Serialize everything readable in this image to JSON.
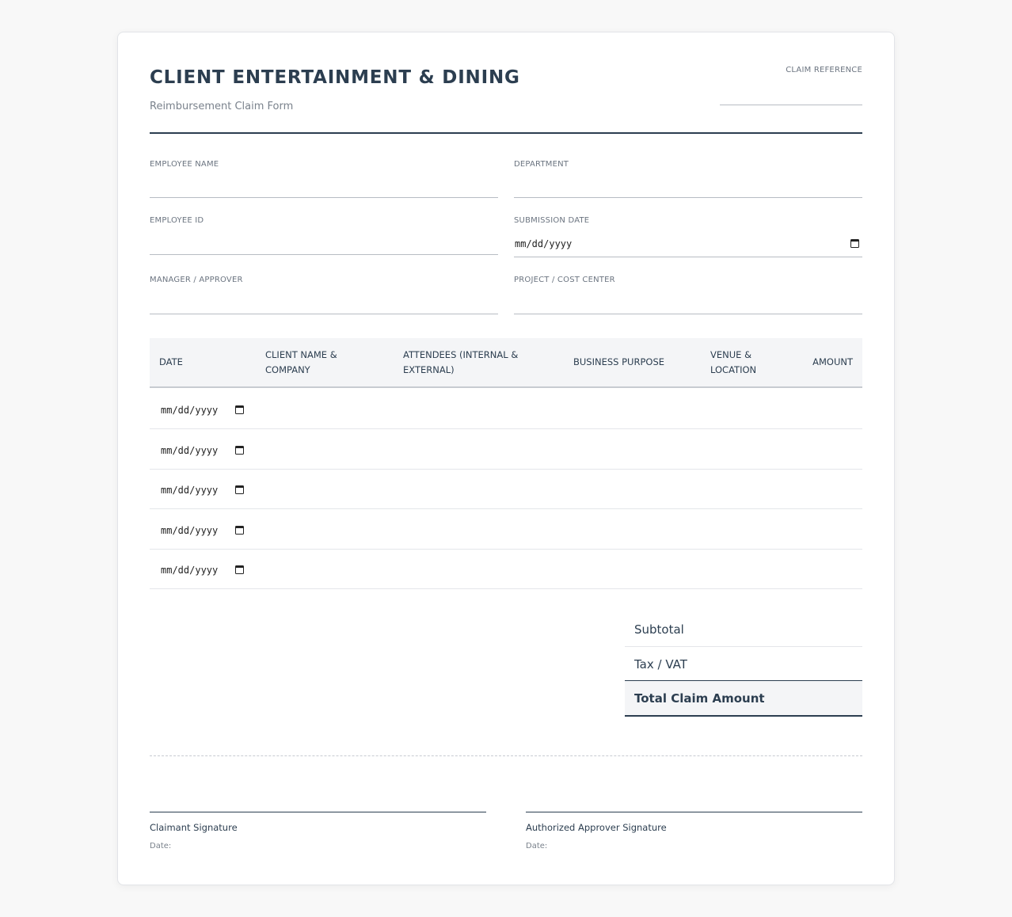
{
  "header": {
    "title": "CLIENT ENTERTAINMENT & DINING",
    "subtitle": "Reimbursement Claim Form",
    "claim_reference_label": "CLAIM REFERENCE",
    "claim_reference_value": ""
  },
  "fields": {
    "employee_name": {
      "label": "EMPLOYEE NAME",
      "value": ""
    },
    "department": {
      "label": "DEPARTMENT",
      "value": ""
    },
    "employee_id": {
      "label": "EMPLOYEE ID",
      "value": ""
    },
    "submission_date": {
      "label": "SUBMISSION DATE",
      "value": "mm/dd/yyyy"
    },
    "manager": {
      "label": "MANAGER / APPROVER",
      "value": ""
    },
    "project": {
      "label": "PROJECT / COST CENTER",
      "value": ""
    }
  },
  "table": {
    "columns": [
      "DATE",
      "CLIENT NAME & COMPANY",
      "ATTENDEES (INTERNAL & EXTERNAL)",
      "BUSINESS PURPOSE",
      "VENUE & LOCATION",
      "AMOUNT"
    ],
    "rows": [
      {
        "date": "mm/dd/yyyy",
        "client": "",
        "attendees": "",
        "purpose": "",
        "venue": "",
        "amount": ""
      },
      {
        "date": "mm/dd/yyyy",
        "client": "",
        "attendees": "",
        "purpose": "",
        "venue": "",
        "amount": ""
      },
      {
        "date": "mm/dd/yyyy",
        "client": "",
        "attendees": "",
        "purpose": "",
        "venue": "",
        "amount": ""
      },
      {
        "date": "mm/dd/yyyy",
        "client": "",
        "attendees": "",
        "purpose": "",
        "venue": "",
        "amount": ""
      },
      {
        "date": "mm/dd/yyyy",
        "client": "",
        "attendees": "",
        "purpose": "",
        "venue": "",
        "amount": ""
      }
    ]
  },
  "summary": {
    "subtotal_label": "Subtotal",
    "tax_label": "Tax / VAT",
    "total_label": "Total Claim Amount"
  },
  "signatures": {
    "claimant_label": "Claimant Signature",
    "approver_label": "Authorized Approver Signature",
    "date_label": "Date:"
  },
  "icons": {
    "calendar": "calendar-icon"
  },
  "colors": {
    "primary": "#2c3e50",
    "muted": "#7a828c",
    "header_bg": "#f4f5f7"
  }
}
